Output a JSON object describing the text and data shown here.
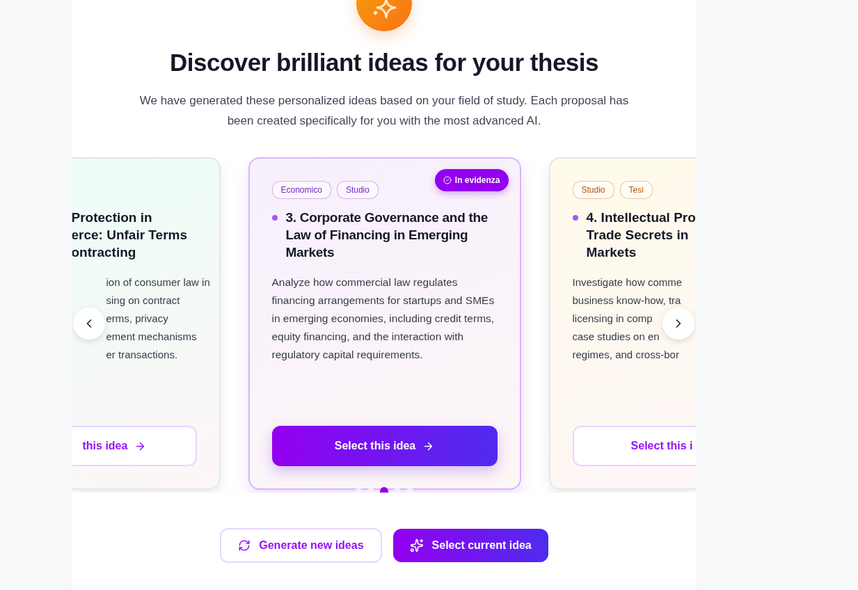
{
  "heading": "Discover brilliant ideas for your thesis",
  "subtitle": "We have generated these personalized ideas based on your field of study. Each proposal has been created specifically for you with the most advanced AI.",
  "cards": [
    {
      "kind": "partial-left",
      "color": "#ecfdf7",
      "selected": false,
      "title_lines": [
        "Protection in",
        "erce: Unfair Terms",
        "ontracting"
      ],
      "description_lines": [
        "ion of consumer law in",
        "sing on contract",
        "erms, privacy",
        "ement mechanisms",
        "er transactions."
      ],
      "button": "this idea"
    },
    {
      "kind": "full",
      "color": "#f7f0fd",
      "selected": true,
      "badge": "In evidenza",
      "tags": [
        {
          "label": "Economico",
          "color": "#7e22ce"
        },
        {
          "label": "Studio",
          "color": "#7e22ce"
        }
      ],
      "title": "3. Corporate Governance and the Law of Financing in Emerging Markets",
      "description": "Analyze how commercial law regulates financing arrangements for startups and SMEs in emerging economies, including credit terms, equity financing, and the interaction with regulatory capital requirements.",
      "button": "Select this idea"
    },
    {
      "kind": "partial-right",
      "color": "#fffbea",
      "selected": false,
      "tags": [
        {
          "label": "Studio",
          "color": "#b45309"
        },
        {
          "label": "Tesi",
          "color": "#b45309"
        }
      ],
      "title_lines": [
        "4. Intellectual Pro",
        "Trade Secrets in",
        "Markets"
      ],
      "description_lines": [
        "Investigate how comme",
        "business know-how, tra",
        "licensing in comp",
        "case studies on en",
        "regimes, and cross-bor"
      ],
      "button": "Select this i"
    }
  ],
  "dots": [
    {
      "selected": false
    },
    {
      "selected": false
    },
    {
      "selected": true
    },
    {
      "selected": false
    },
    {
      "selected": false
    }
  ],
  "actions": [
    {
      "kind": "secondary",
      "label": "Generate new ideas"
    },
    {
      "kind": "primary",
      "label": "Select current idea"
    }
  ]
}
